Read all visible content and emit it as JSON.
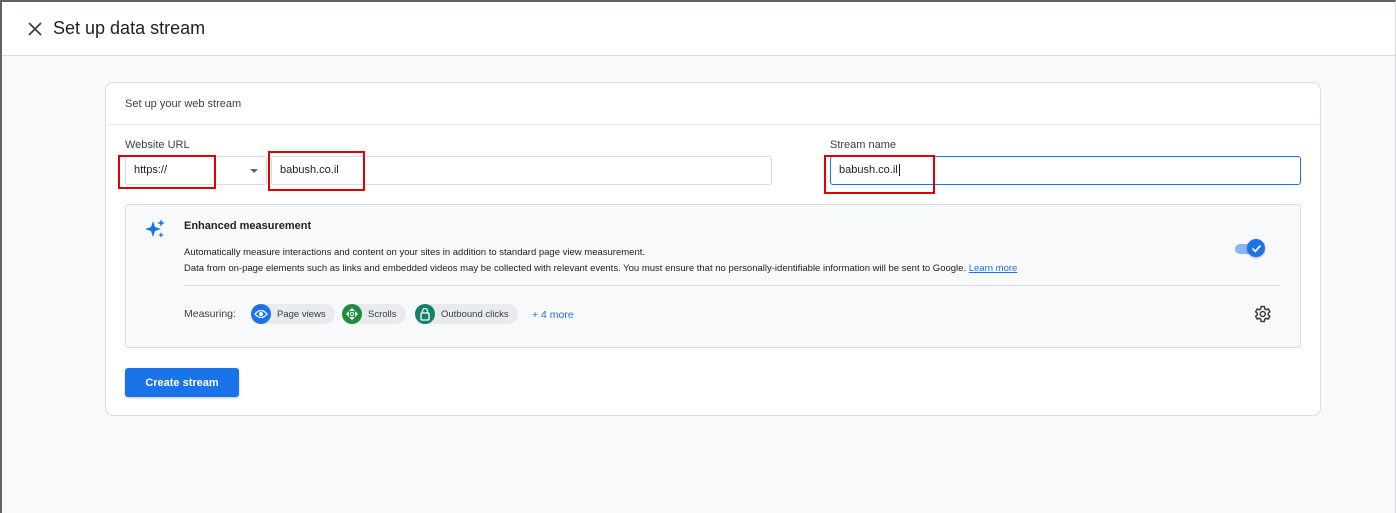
{
  "header": {
    "title": "Set up data stream",
    "close_icon": "close-icon"
  },
  "card": {
    "title": "Set up your web stream",
    "website_url": {
      "label": "Website URL",
      "protocol_value": "https://",
      "domain_value": "babush.co.il"
    },
    "stream_name": {
      "label": "Stream name",
      "value": "babush.co.il"
    },
    "enhanced_measurement": {
      "title": "Enhanced measurement",
      "description_line1": "Automatically measure interactions and content on your sites in addition to standard page view measurement.",
      "description_line2": "Data from on-page elements such as links and embedded videos may be collected with relevant events. You must ensure that no personally-identifiable information will be sent to Google.",
      "learn_more": "Learn more",
      "enabled": true,
      "measuring_label": "Measuring:",
      "chips": [
        {
          "label": "Page views",
          "icon": "eye-icon",
          "color": "#1a73e8"
        },
        {
          "label": "Scrolls",
          "icon": "scroll-icon",
          "color": "#1e8e3e"
        },
        {
          "label": "Outbound clicks",
          "icon": "lock-icon",
          "color": "#12806a"
        }
      ],
      "more_link": "+ 4 more"
    },
    "create_button": "Create stream"
  },
  "colors": {
    "accent": "#1a73e8",
    "highlight_red": "#e00000"
  }
}
